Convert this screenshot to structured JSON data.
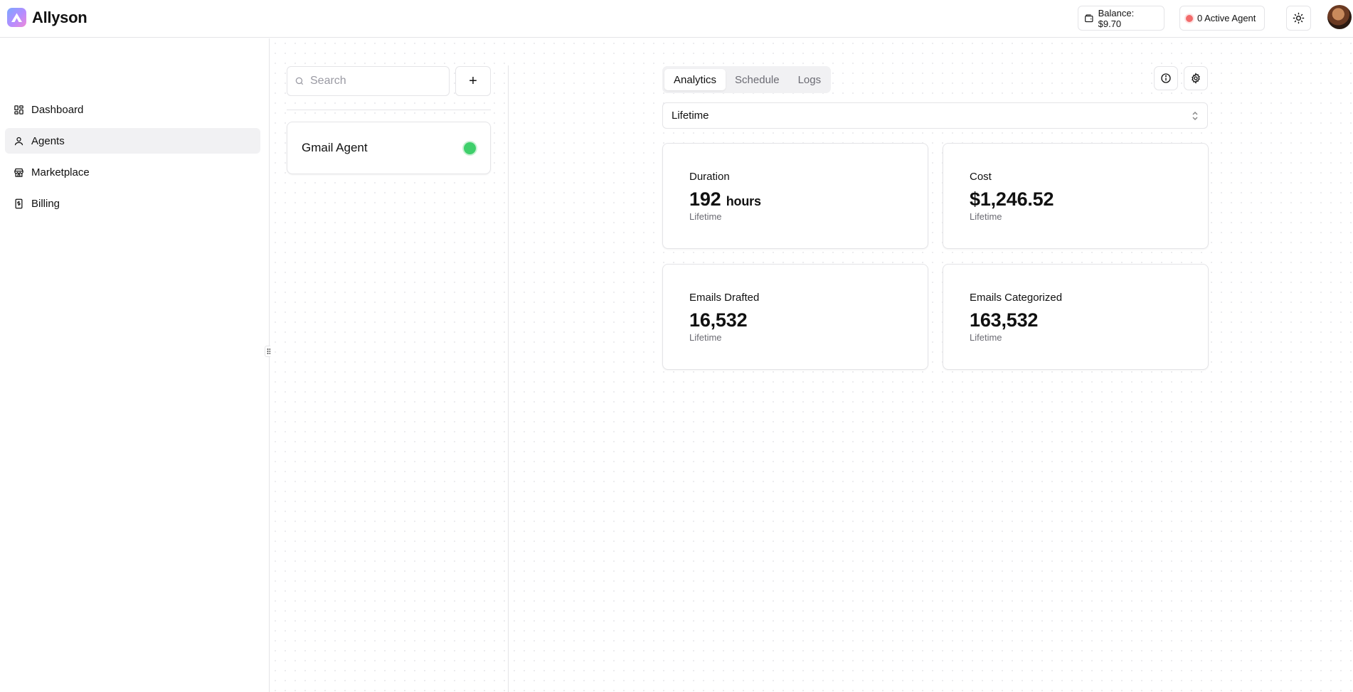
{
  "app": {
    "name": "Allyson"
  },
  "header": {
    "balance_label": "Balance: $9.70",
    "active_agent_label": "0 Active Agent",
    "status_color": "#f26b6b",
    "accent_color": "#b58cff"
  },
  "sidebar": {
    "items": [
      {
        "label": "Dashboard",
        "icon": "dashboard-icon",
        "active": false
      },
      {
        "label": "Agents",
        "icon": "user-icon",
        "active": true
      },
      {
        "label": "Marketplace",
        "icon": "store-icon",
        "active": false
      },
      {
        "label": "Billing",
        "icon": "receipt-icon",
        "active": false
      }
    ]
  },
  "agents_list": {
    "search_placeholder": "Search",
    "add_label": "+",
    "agents": [
      {
        "name": "Gmail Agent",
        "status_color": "#3fcf6b"
      }
    ]
  },
  "detail": {
    "tabs": [
      {
        "label": "Analytics",
        "active": true
      },
      {
        "label": "Schedule",
        "active": false
      },
      {
        "label": "Logs",
        "active": false
      }
    ],
    "period_select": {
      "value": "Lifetime"
    },
    "stats": [
      {
        "label": "Duration",
        "value": "192",
        "unit": "hours",
        "sub": "Lifetime"
      },
      {
        "label": "Cost",
        "value": "$1,246.52",
        "unit": "",
        "sub": "Lifetime"
      },
      {
        "label": "Emails Drafted",
        "value": "16,532",
        "unit": "",
        "sub": "Lifetime"
      },
      {
        "label": "Emails Categorized",
        "value": "163,532",
        "unit": "",
        "sub": "Lifetime"
      }
    ]
  }
}
